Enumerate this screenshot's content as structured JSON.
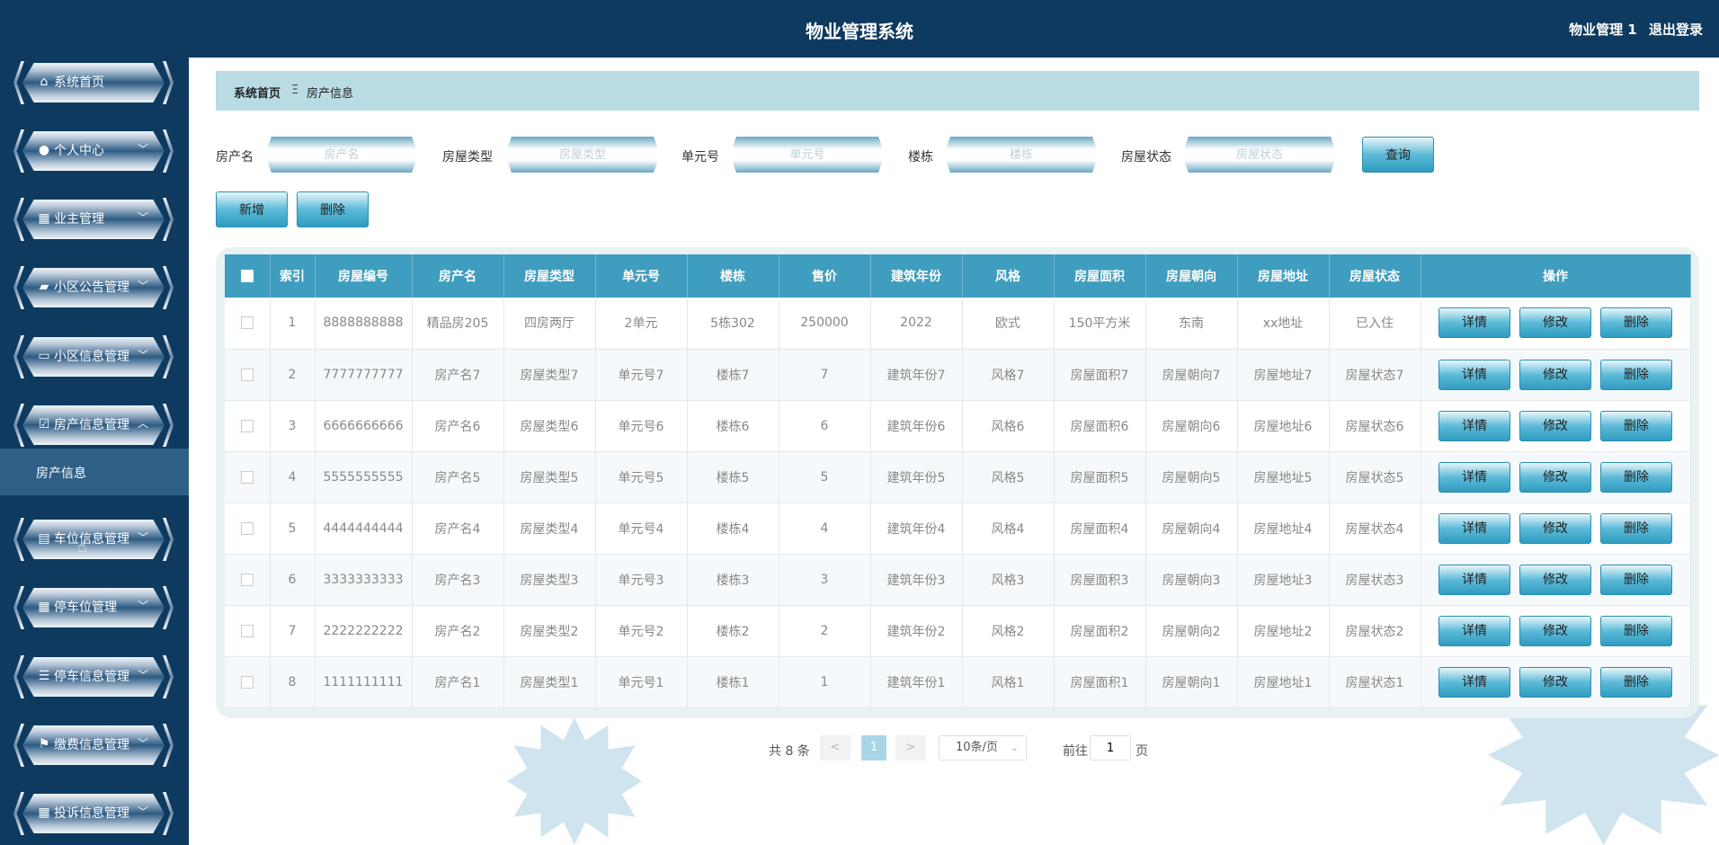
{
  "header": {
    "title": "物业管理系统",
    "user": "物业管理 1",
    "logout": "退出登录"
  },
  "sidebar": {
    "items": [
      {
        "label": "系统首页",
        "icon": "home-icon"
      },
      {
        "label": "个人中心",
        "icon": "user-icon"
      },
      {
        "label": "业主管理",
        "icon": "grid-icon"
      },
      {
        "label": "小区公告管理",
        "icon": "notice-icon"
      },
      {
        "label": "小区信息管理",
        "icon": "monitor-icon"
      },
      {
        "label": "房产信息管理",
        "icon": "clipboard-check-icon"
      },
      {
        "label": "车位信息管理",
        "icon": "clipboard-icon"
      },
      {
        "label": "停车位管理",
        "icon": "grid-icon"
      },
      {
        "label": "停车信息管理",
        "icon": "list-icon"
      },
      {
        "label": "缴费信息管理",
        "icon": "flag-icon"
      },
      {
        "label": "投诉信息管理",
        "icon": "grid-icon"
      }
    ],
    "submenu_label": "房产信息"
  },
  "breadcrumb": {
    "home": "系统首页",
    "separator": "Ξ",
    "current": "房产信息"
  },
  "search": {
    "fields": [
      {
        "label": "房产名",
        "placeholder": "房产名"
      },
      {
        "label": "房屋类型",
        "placeholder": "房屋类型"
      },
      {
        "label": "单元号",
        "placeholder": "单元号"
      },
      {
        "label": "楼栋",
        "placeholder": "楼栋"
      },
      {
        "label": "房屋状态",
        "placeholder": "房屋状态"
      }
    ],
    "query_label": "查询"
  },
  "toolbar": {
    "add_label": "新增",
    "delete_label": "删除"
  },
  "table": {
    "headers": [
      "索引",
      "房屋编号",
      "房产名",
      "房屋类型",
      "单元号",
      "楼栋",
      "售价",
      "建筑年份",
      "风格",
      "房屋面积",
      "房屋朝向",
      "房屋地址",
      "房屋状态",
      "操作"
    ],
    "rows": [
      [
        "1",
        "8888888888",
        "精品房205",
        "四房两厅",
        "2单元",
        "5栋302",
        "250000",
        "2022",
        "欧式",
        "150平方米",
        "东南",
        "xx地址",
        "已入住"
      ],
      [
        "2",
        "7777777777",
        "房产名7",
        "房屋类型7",
        "单元号7",
        "楼栋7",
        "7",
        "建筑年份7",
        "风格7",
        "房屋面积7",
        "房屋朝向7",
        "房屋地址7",
        "房屋状态7"
      ],
      [
        "3",
        "6666666666",
        "房产名6",
        "房屋类型6",
        "单元号6",
        "楼栋6",
        "6",
        "建筑年份6",
        "风格6",
        "房屋面积6",
        "房屋朝向6",
        "房屋地址6",
        "房屋状态6"
      ],
      [
        "4",
        "5555555555",
        "房产名5",
        "房屋类型5",
        "单元号5",
        "楼栋5",
        "5",
        "建筑年份5",
        "风格5",
        "房屋面积5",
        "房屋朝向5",
        "房屋地址5",
        "房屋状态5"
      ],
      [
        "5",
        "4444444444",
        "房产名4",
        "房屋类型4",
        "单元号4",
        "楼栋4",
        "4",
        "建筑年份4",
        "风格4",
        "房屋面积4",
        "房屋朝向4",
        "房屋地址4",
        "房屋状态4"
      ],
      [
        "6",
        "3333333333",
        "房产名3",
        "房屋类型3",
        "单元号3",
        "楼栋3",
        "3",
        "建筑年份3",
        "风格3",
        "房屋面积3",
        "房屋朝向3",
        "房屋地址3",
        "房屋状态3"
      ],
      [
        "7",
        "2222222222",
        "房产名2",
        "房屋类型2",
        "单元号2",
        "楼栋2",
        "2",
        "建筑年份2",
        "风格2",
        "房屋面积2",
        "房屋朝向2",
        "房屋地址2",
        "房屋状态2"
      ],
      [
        "8",
        "1111111111",
        "房产名1",
        "房屋类型1",
        "单元号1",
        "楼栋1",
        "1",
        "建筑年份1",
        "风格1",
        "房屋面积1",
        "房屋朝向1",
        "房屋地址1",
        "房屋状态1"
      ]
    ],
    "actions": [
      "详情",
      "修改",
      "删除"
    ]
  },
  "pagination": {
    "total": "共 8 条",
    "prev": "<",
    "current_page": "1",
    "next": ">",
    "page_size": "10条/页",
    "goto_label": "前往",
    "goto_value": "1",
    "page_suffix": "页"
  },
  "colors": {
    "sidebar_bg": "#0e3a60",
    "breadcrumb_bg": "#b9dbe4",
    "table_header": "#3f9dbf",
    "accent": "#2f9cc0"
  }
}
